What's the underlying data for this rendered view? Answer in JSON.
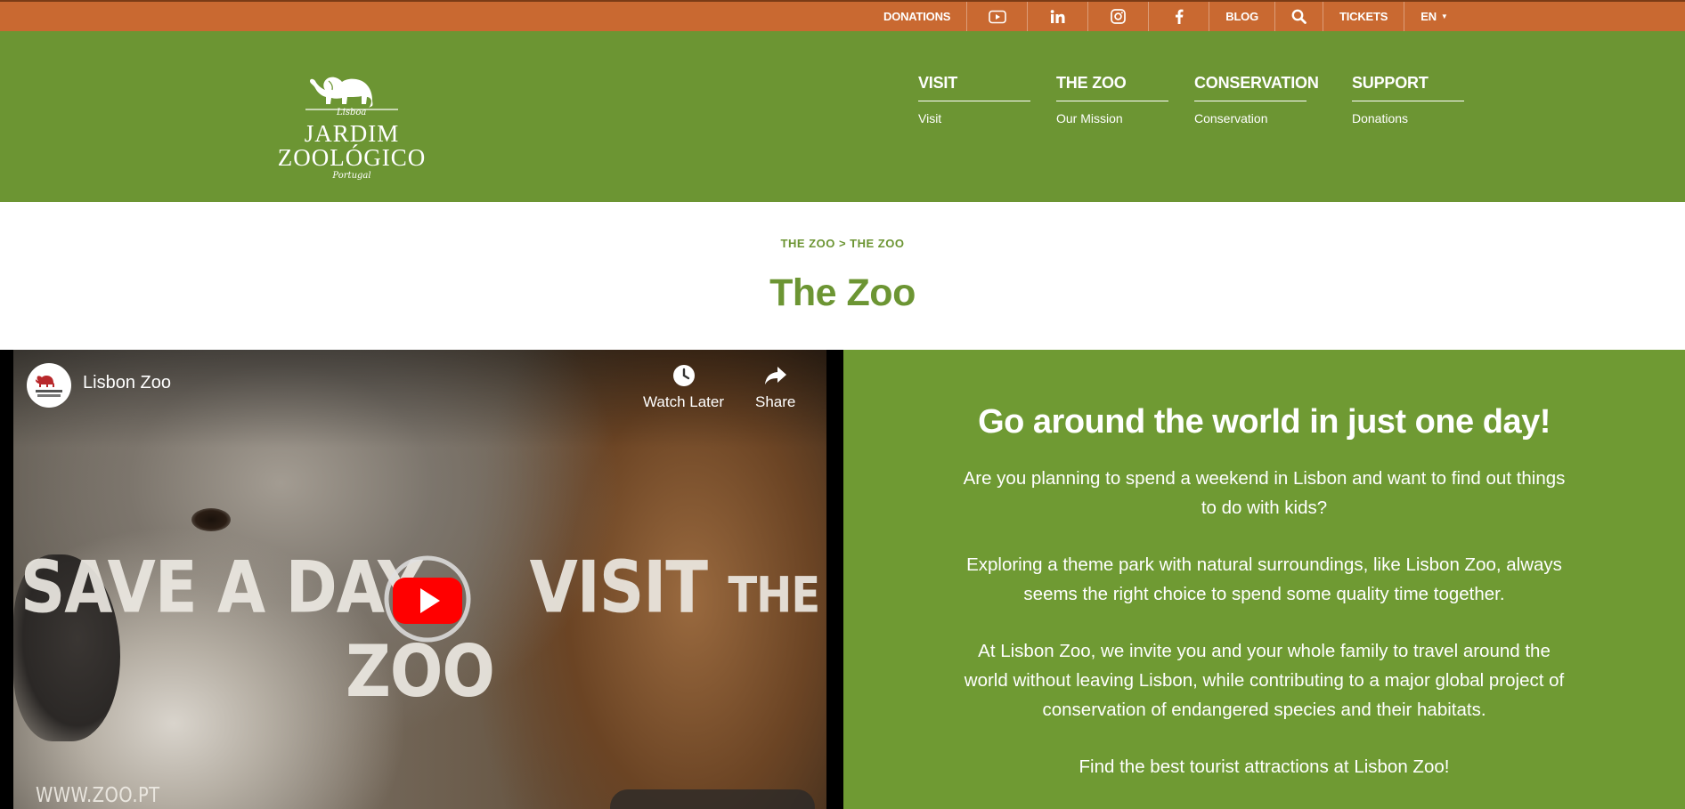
{
  "topbar": {
    "donations": "DONATIONS",
    "blog": "BLOG",
    "tickets": "TICKETS",
    "language": "EN",
    "icons": [
      "youtube-icon",
      "linkedin-icon",
      "instagram-icon",
      "facebook-icon",
      "search-icon"
    ],
    "colors": {
      "background": "#c96931"
    }
  },
  "logo": {
    "small_text": "Lisboa",
    "line1": "JARDIM",
    "line2": "ZOOLÓGICO",
    "sub_text": "Portugal"
  },
  "nav": [
    {
      "label": "VISIT",
      "sub": "Visit"
    },
    {
      "label": "THE ZOO",
      "sub": "Our Mission"
    },
    {
      "label": "CONSERVATION",
      "sub": "Conservation"
    },
    {
      "label": "SUPPORT",
      "sub": "Donations"
    }
  ],
  "breadcrumb": {
    "first": "THE ZOO",
    "separator": ">",
    "second": "THE ZOO"
  },
  "page_title": "The Zoo",
  "video": {
    "channel_name": "Lisbon Zoo",
    "watch_later": "Watch Later",
    "share": "Share",
    "tagline_part1": "SAVE A DAY,",
    "tagline_part2": "VISIT",
    "tagline_part3": "THE",
    "tagline_part4": "ZOO",
    "watermark": "WWW.ZOO.PT"
  },
  "content": {
    "heading": "Go around the world in just one day!",
    "p1": "Are you planning to spend a weekend in Lisbon and want to find out things to do with kids?",
    "p2": "Exploring a theme park with natural surroundings, like Lisbon Zoo, always seems the right choice to spend some quality time together.",
    "p3": "At Lisbon Zoo, we invite you and your whole family to travel around the world without leaving Lisbon, while contributing to a major global project of conservation of endangered species and their habitats.",
    "p4": "Find the best tourist attractions at Lisbon Zoo!"
  },
  "colors": {
    "brand_green": "#6c9533",
    "accent_orange": "#c96931",
    "youtube_red": "#ff0000"
  }
}
